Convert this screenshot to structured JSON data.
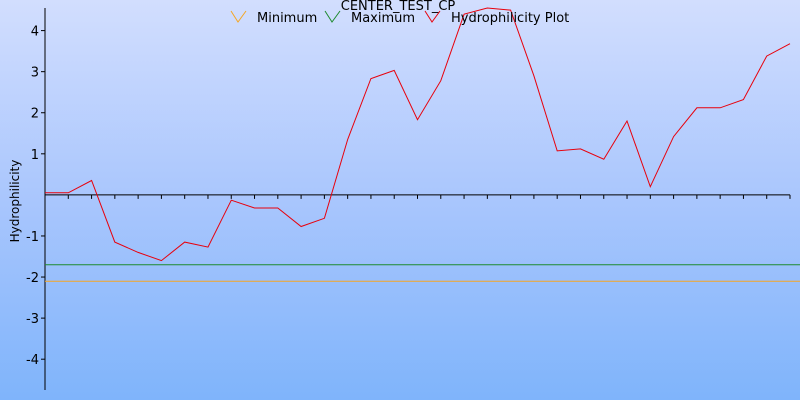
{
  "chart_data": {
    "type": "line",
    "title": "CENTER_TEST_CP",
    "ylabel": "Hydrophilicity",
    "xlabel": "",
    "ylim": [
      -4.75,
      4.55
    ],
    "yticks": [
      4,
      3,
      2,
      1,
      -1,
      -2,
      -3,
      -4
    ],
    "x_count": 33,
    "grid": false,
    "legend_position": "top-center",
    "series": [
      {
        "name": "Minimum",
        "color": "#f5a623",
        "values": [
          -2.1,
          -2.1
        ]
      },
      {
        "name": "Maximum",
        "color": "#1e8a2e",
        "values": [
          -1.7,
          -1.7
        ]
      },
      {
        "name": "Hydrophilicity Plot",
        "color": "#e8000b",
        "values": [
          0.05,
          0.05,
          0.35,
          -1.15,
          -1.4,
          -1.6,
          -1.15,
          -1.27,
          -0.13,
          -0.32,
          -0.32,
          -0.77,
          -0.57,
          1.35,
          2.83,
          3.03,
          1.83,
          2.78,
          4.4,
          4.55,
          4.5,
          2.9,
          1.07,
          1.12,
          0.87,
          1.8,
          0.2,
          1.42,
          2.12,
          2.12,
          2.32,
          3.38,
          3.68
        ]
      }
    ]
  }
}
